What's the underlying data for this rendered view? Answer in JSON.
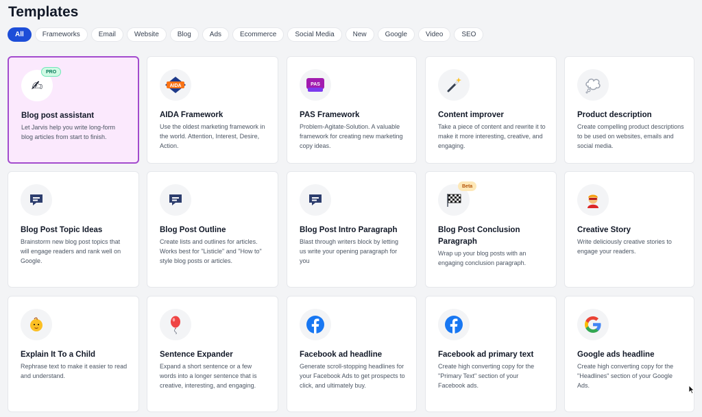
{
  "page": {
    "title": "Templates"
  },
  "filters": [
    "All",
    "Frameworks",
    "Email",
    "Website",
    "Blog",
    "Ads",
    "Ecommerce",
    "Social Media",
    "New",
    "Google",
    "Video",
    "SEO"
  ],
  "active_filter": "All",
  "colors": {
    "accent": "#1d4ed8",
    "selected_border": "#a24acd",
    "selected_bg": "#fbe9fd"
  },
  "badges": {
    "pro": "PRO",
    "beta": "Beta"
  },
  "icons": {
    "aida": "AIDA",
    "pas": "PAS"
  },
  "templates": [
    {
      "title": "Blog post assistant",
      "desc": "Let Jarvis help you write long-form blog articles from start to finish.",
      "icon": "writing-hand-icon"
    },
    {
      "title": "AIDA Framework",
      "desc": "Use the oldest marketing framework in the world. Attention, Interest, Desire, Action.",
      "icon": "aida-icon"
    },
    {
      "title": "PAS Framework",
      "desc": "Problem-Agitate-Solution. A valuable framework for creating new marketing copy ideas.",
      "icon": "pas-icon"
    },
    {
      "title": "Content improver",
      "desc": "Take a piece of content and rewrite it to make it more interesting, creative, and engaging.",
      "icon": "magic-wand-icon"
    },
    {
      "title": "Product description",
      "desc": "Create compelling product descriptions to be used on websites, emails and social media.",
      "icon": "thought-bubble-icon"
    },
    {
      "title": "Blog Post Topic Ideas",
      "desc": "Brainstorm new blog post topics that will engage readers and rank well on Google.",
      "icon": "chat-icon"
    },
    {
      "title": "Blog Post Outline",
      "desc": "Create lists and outlines for articles. Works best for \"Listicle\" and \"How to\" style blog posts or articles.",
      "icon": "chat-icon"
    },
    {
      "title": "Blog Post Intro Paragraph",
      "desc": "Blast through writers block by letting us write your opening paragraph for you",
      "icon": "chat-icon"
    },
    {
      "title": "Blog Post Conclusion Paragraph",
      "desc": "Wrap up your blog posts with an engaging conclusion paragraph.",
      "icon": "checkered-flag-icon"
    },
    {
      "title": "Creative Story",
      "desc": "Write deliciously creative stories to engage your readers.",
      "icon": "superhero-icon"
    },
    {
      "title": "Explain It To a Child",
      "desc": "Rephrase text to make it easier to read and understand.",
      "icon": "baby-icon"
    },
    {
      "title": "Sentence Expander",
      "desc": "Expand a short sentence or a few words into a longer sentence that is creative, interesting, and engaging.",
      "icon": "balloon-icon"
    },
    {
      "title": "Facebook ad headline",
      "desc": "Generate scroll-stopping headlines for your Facebook Ads to get prospects to click, and ultimately buy.",
      "icon": "facebook-icon"
    },
    {
      "title": "Facebook ad primary text",
      "desc": "Create high converting copy for the \"Primary Text\" section of your Facebook ads.",
      "icon": "facebook-icon"
    },
    {
      "title": "Google ads headline",
      "desc": "Create high converting copy for the \"Headlines\" section of your Google Ads.",
      "icon": "google-icon"
    }
  ]
}
